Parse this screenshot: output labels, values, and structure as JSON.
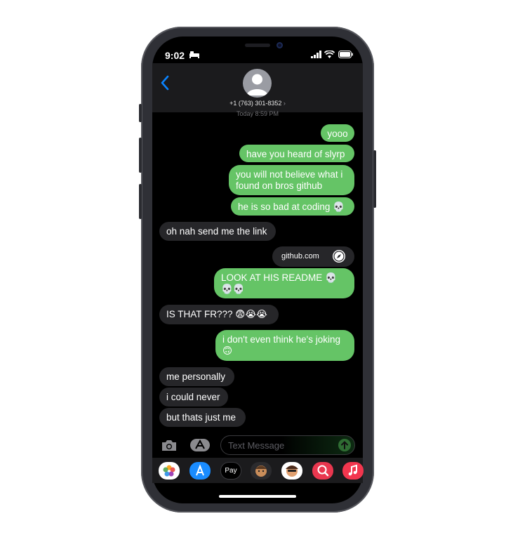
{
  "status_bar": {
    "time": "9:02"
  },
  "header": {
    "phone_number": "+1 (763) 301-8352",
    "timestamp": "Today 8:59 PM"
  },
  "messages": [
    {
      "from": "me",
      "text": "yooo"
    },
    {
      "from": "me",
      "text": "have you heard of slyrp"
    },
    {
      "from": "me",
      "text": "you will not believe what i found on bros github"
    },
    {
      "from": "me",
      "text": "he is so bad at coding 💀"
    },
    {
      "from": "them",
      "text": "oh nah send me the link"
    },
    {
      "from": "me",
      "link": "github.com"
    },
    {
      "from": "me",
      "text": "LOOK AT HIS README 💀💀💀"
    },
    {
      "from": "them",
      "text": "IS THAT FR??? 😨😭😭"
    },
    {
      "from": "me",
      "text": "i don't even think he's joking 🙃"
    },
    {
      "from": "them",
      "text": "me personally"
    },
    {
      "from": "them",
      "text": "i could never"
    },
    {
      "from": "them",
      "text": "but thats just me"
    }
  ],
  "compose": {
    "placeholder": "Text Message"
  },
  "app_strip": [
    {
      "name": "Photos",
      "icon": "photos-icon"
    },
    {
      "name": "App Store",
      "icon": "app-store-icon"
    },
    {
      "name": "Apple Pay",
      "label": "Pay",
      "icon": "apple-pay-icon"
    },
    {
      "name": "Memoji",
      "icon": "memoji-icon"
    },
    {
      "name": "Memoji Stickers",
      "icon": "memoji-stickers-icon"
    },
    {
      "name": "Images",
      "icon": "image-search-icon"
    },
    {
      "name": "Music",
      "icon": "music-icon"
    }
  ],
  "colors": {
    "outgoing": "#65c466",
    "incoming": "#262629",
    "accent": "#0a84ff"
  }
}
